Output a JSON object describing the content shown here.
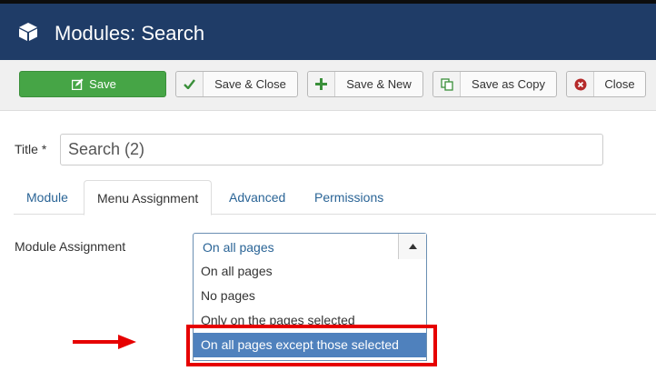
{
  "header": {
    "title": "Modules: Search",
    "icon": "cube-icon"
  },
  "toolbar": {
    "save_label": "Save",
    "save_close_label": "Save & Close",
    "save_new_label": "Save & New",
    "save_copy_label": "Save as Copy",
    "close_label": "Close"
  },
  "form": {
    "title_label": "Title *",
    "title_value": "Search (2)"
  },
  "tabs": [
    {
      "label": "Module"
    },
    {
      "label": "Menu Assignment",
      "active": true
    },
    {
      "label": "Advanced"
    },
    {
      "label": "Permissions"
    }
  ],
  "assignment": {
    "label": "Module Assignment",
    "selected": "On all pages",
    "options": [
      "On all pages",
      "No pages",
      "Only on the pages selected",
      "On all pages except those selected"
    ],
    "highlighted_option": "On all pages except those selected"
  },
  "colors": {
    "header_bg": "#1f3c67",
    "save_green": "#46a546",
    "link_blue": "#2a6496",
    "highlight_blue": "#4f81bd",
    "annotation_red": "#e60000"
  }
}
